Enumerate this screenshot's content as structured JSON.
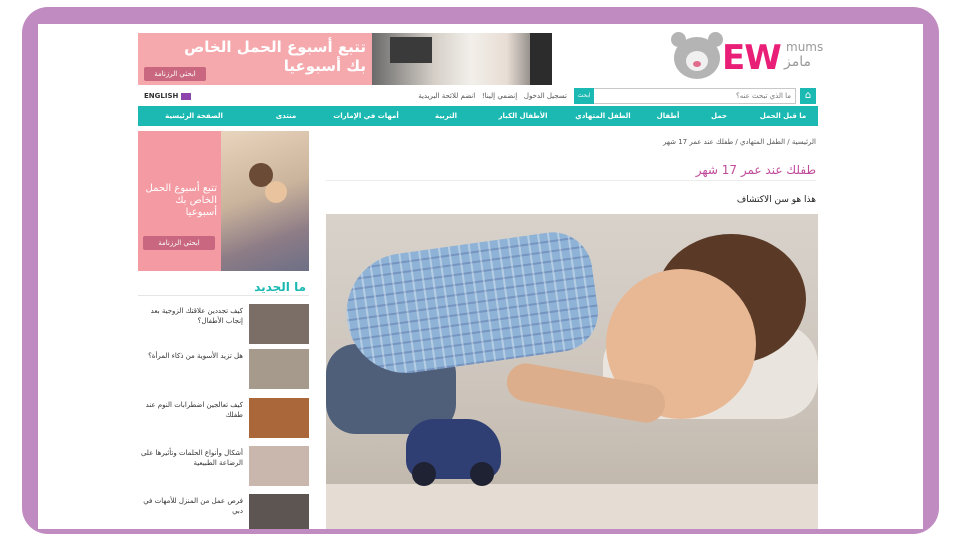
{
  "header": {
    "banner_title": "تتبع أسبوع الحمل الخاص بك أسبوعيا",
    "banner_button": "ابحثي الرزنامة",
    "logo_text": "EW",
    "logo_tag_en": "mums",
    "logo_tag_ar": "مامز",
    "util_links": [
      "تسجيل الدخول",
      "إنضمي إلينا!",
      "انضم للائحة البريدية"
    ],
    "lang": "ENGLISH",
    "search_placeholder": "ما الذي تبحث عنه؟",
    "search_button": "ابحث"
  },
  "nav": {
    "items": [
      "ما قبل الحمل",
      "حمل",
      "أطفال",
      "الطفل المتهادي",
      "الأطفال الكبار",
      "التربية",
      "أمهات في الإمارات",
      "منتدى",
      "الصفحة الرئيسية"
    ]
  },
  "sidebar": {
    "promo_text": "تتبع أسبوع الحمل الخاص بك أسبوعيا",
    "promo_button": "ابحثي الرزنامة",
    "latest_title": "ما الجديد",
    "news": [
      {
        "title": "كيف تجددين علاقتك الزوجية بعد إنجاب الأطفال؟",
        "thumb": "#7a6e66"
      },
      {
        "title": "هل تزيد الأسوية من ذكاء المرأة؟",
        "thumb": "#a59a8c"
      },
      {
        "title": "كيف تعالجين اضطرابات النوم عند طفلك",
        "thumb": "#a9673a"
      },
      {
        "title": "أشكال وأنواع الحلمات وتأثيرها على الرضاعة الطبيعية",
        "thumb": "#c9b7ae"
      },
      {
        "title": "فرص عمل من المنزل للأمهات في دبي",
        "thumb": "#5c5552"
      }
    ]
  },
  "article": {
    "breadcrumb": "الرئيسية / الطفل المتهادي / طفلك عند عمر 17 شهر",
    "title": "طفلك عند عمر 17 شهر",
    "subtitle": "هذا هو سن الاكتشاف"
  },
  "colors": {
    "frame": "#c08bc0",
    "accent": "#1bb9b1",
    "title": "#c04a9a",
    "promo": "#f49aa3",
    "logo": "#e91e77"
  }
}
